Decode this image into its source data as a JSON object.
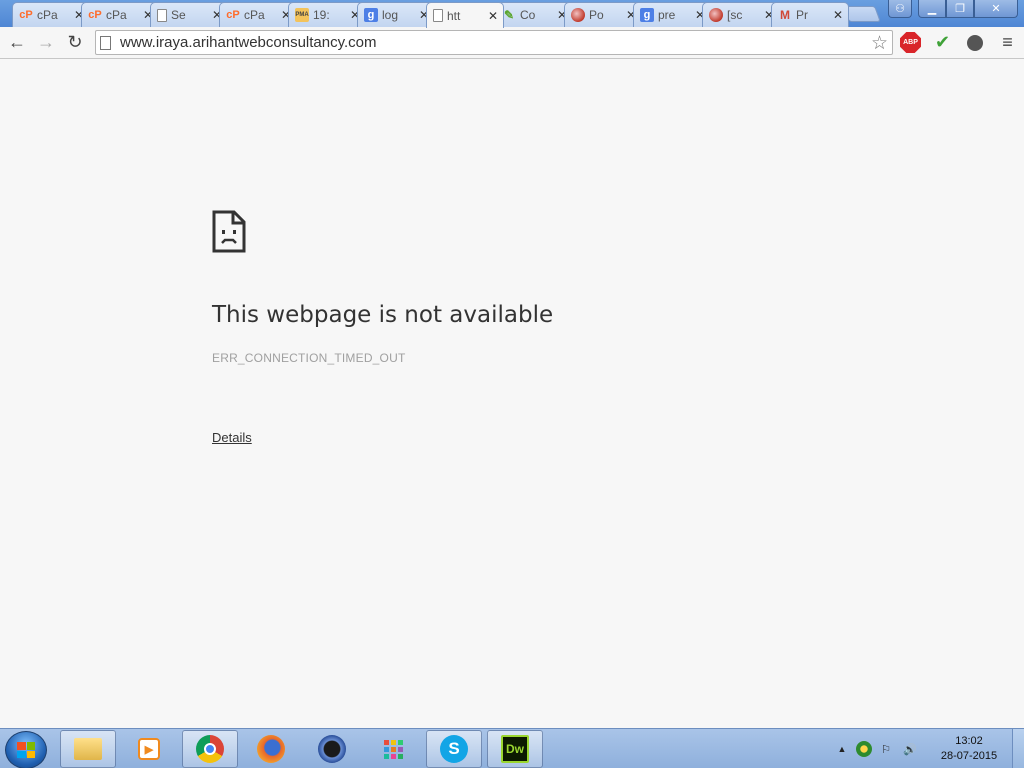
{
  "browser": {
    "tabs": [
      {
        "title": "cPa",
        "icon": "cpanel-icon",
        "favclass": "cp",
        "fav_text": "cP"
      },
      {
        "title": "cPa",
        "icon": "cpanel-icon",
        "favclass": "cp",
        "fav_text": "cP"
      },
      {
        "title": "Se",
        "icon": "page-icon",
        "favclass": "doc",
        "fav_text": ""
      },
      {
        "title": "cPa",
        "icon": "cpanel-icon",
        "favclass": "cp",
        "fav_text": "cP"
      },
      {
        "title": "19:",
        "icon": "phpmyadmin-icon",
        "favclass": "pma",
        "fav_text": "PMA"
      },
      {
        "title": "log",
        "icon": "google-icon",
        "favclass": "goog",
        "fav_text": "g"
      },
      {
        "title": "htt",
        "icon": "page-icon",
        "favclass": "doc",
        "fav_text": "",
        "active": true
      },
      {
        "title": "Co",
        "icon": "pencil-icon",
        "favclass": "pen",
        "fav_text": "✎"
      },
      {
        "title": "Po",
        "icon": "globe-icon",
        "favclass": "globe",
        "fav_text": ""
      },
      {
        "title": "pre",
        "icon": "google-icon",
        "favclass": "goog",
        "fav_text": "g"
      },
      {
        "title": "[sc",
        "icon": "globe-icon",
        "favclass": "globe",
        "fav_text": ""
      },
      {
        "title": "Pr",
        "icon": "gmail-icon",
        "favclass": "gmail",
        "fav_text": "M"
      }
    ],
    "close_glyph": "✕",
    "window_controls": {
      "user": "⚇",
      "minimize": "▁",
      "maximize": "❐",
      "close": "✕"
    },
    "toolbar": {
      "back": "←",
      "forward": "→",
      "reload": "↻",
      "url": "www.iraya.arihantwebconsultancy.com",
      "star": "☆",
      "abp_label": "ABP",
      "shield": "✔",
      "menu": "≡"
    }
  },
  "error_page": {
    "title": "This webpage is not available",
    "code": "ERR_CONNECTION_TIMED_OUT",
    "details_link": "Details"
  },
  "taskbar": {
    "apps": [
      {
        "name": "explorer-icon",
        "class": "folder",
        "label": "",
        "pinned": true
      },
      {
        "name": "media-player-icon",
        "class": "media",
        "label": "▶",
        "pinned": false
      },
      {
        "name": "chrome-icon",
        "class": "chrome",
        "label": "",
        "pinned": true
      },
      {
        "name": "firefox-icon",
        "class": "firefox",
        "label": "",
        "pinned": false
      },
      {
        "name": "quicktime-icon",
        "class": "quicktime",
        "label": "",
        "pinned": false
      },
      {
        "name": "apps-grid-icon",
        "class": "apps",
        "label": "",
        "pinned": false
      },
      {
        "name": "skype-icon",
        "class": "skype",
        "label": "S",
        "pinned": true
      },
      {
        "name": "dreamweaver-icon",
        "class": "dw",
        "label": "Dw",
        "pinned": true
      }
    ],
    "tray": {
      "up_arrow": "▲",
      "flag": "⚐",
      "volume": "🔊"
    },
    "clock": {
      "time": "13:02",
      "date": "28-07-2015"
    }
  },
  "colors": {
    "tabstrip": "#5a8fd8",
    "page_bg": "#f7f7f7",
    "title_text": "#333333",
    "code_text": "#a0a0a0"
  }
}
